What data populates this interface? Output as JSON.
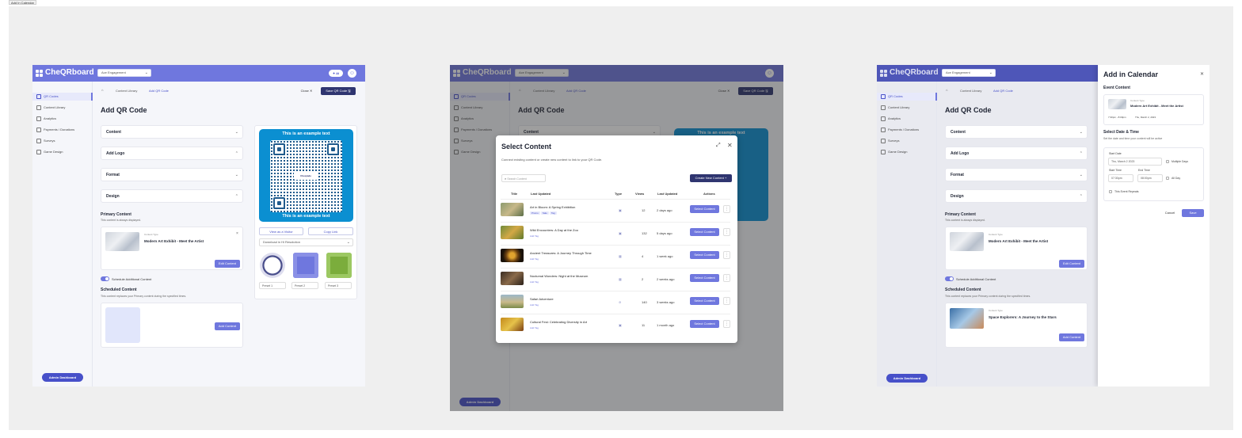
{
  "frame_label": "Add In Calendar",
  "app": {
    "logo": "CheQRboard",
    "engagement_select": "Ace Engagement",
    "ai_pill": "✦ AI",
    "nav": [
      "QR Codes",
      "Content Library",
      "Analytics",
      "Payments / Donations",
      "Surveys",
      "Game Design"
    ],
    "admin_button": "Admin Dashboard"
  },
  "breadcrumb": {
    "content_library": "Content Library",
    "add_qr": "Add QR Code"
  },
  "toolbar": {
    "close": "Close ✕",
    "save": "Save QR Code 🖫"
  },
  "page_title": "Add QR Code",
  "accordions": [
    "Content",
    "Add Logo",
    "Format",
    "Design"
  ],
  "primary": {
    "title": "Primary Content",
    "subtitle": "This content is always displayed.",
    "content_type_label": "Content Type",
    "content_title": "Modern Art Exhibit - Meet the Artist",
    "edit_button": "Edit Content"
  },
  "schedule": {
    "toggle_label": "Schedule Additional Content",
    "title": "Scheduled Content",
    "subtitle": "This content replaces your Primary content during the specified times.",
    "add_button": "Add Content",
    "second_type_label": "Content Type",
    "second_title": "Space Explorers: A Journey to the Stars",
    "second_add_button": "Add Content"
  },
  "preview": {
    "top_text": "This is an example text",
    "bottom_text": "This is an example text",
    "qr_logo": "Cheqrade",
    "view_visitor": "View as a Visitor",
    "copy_link": "Copy Link",
    "download": "Download in Hi Resolution",
    "presets": [
      "Preset 1",
      "Preset 2",
      "Preset 3"
    ]
  },
  "select_modal": {
    "title": "Select Content",
    "subtitle": "Connect existing content or create new content to link to your QR Code.",
    "search_placeholder": "Search Content",
    "create_button": "Create New Content",
    "columns": [
      "Title",
      "Last Updated",
      "Type",
      "Views",
      "Last Updated",
      "Actions"
    ],
    "rows": [
      {
        "title": "Art in Bloom: A Spring Exhibition",
        "tags": [
          "Promo",
          "Sale",
          "Tag"
        ],
        "type": "▣",
        "views": "12",
        "updated": "2 days ago"
      },
      {
        "title": "Wild Encounters: A Day at the Zoo",
        "tags": [
          "Add Tag"
        ],
        "type": "▣",
        "views": "132",
        "updated": "5 days ago"
      },
      {
        "title": "Ancient Treasures: A Journey Through Time",
        "tags": [
          "Add Tag"
        ],
        "type": "▦",
        "views": "4",
        "updated": "1 week ago"
      },
      {
        "title": "Nocturnal Wonders: Night at the Museum",
        "tags": [
          "Add Tag"
        ],
        "type": "▦",
        "views": "2",
        "updated": "2 weeks ago"
      },
      {
        "title": "Safari Adventure",
        "tags": [
          "Add Tag"
        ],
        "type": "⊘",
        "views": "140",
        "updated": "3 weeks ago"
      },
      {
        "title": "Cultural Fest: Celebrating Diversity in Art",
        "tags": [
          "Add Tag"
        ],
        "type": "▣",
        "views": "11",
        "updated": "1 month ago"
      }
    ],
    "row_button": "Select Content"
  },
  "calendar_panel": {
    "title": "Add in Calendar",
    "event_content": "Event Content",
    "content_type_label": "Content Type",
    "content_title": "Modern Art Exhibit - Meet the Artist",
    "time_range": "7:30pm - 8:00pm",
    "date_text": "Thu, March 2, 2023",
    "select_date_time": "Select Date & Time",
    "select_sub": "Set the date and time your content will be active",
    "start_date_label": "Start Date",
    "start_date": "Thu, March 2 2023",
    "multiple_days": "Multiple Days",
    "start_time_label": "Start Time",
    "end_time_label": "End Time",
    "start_time": "07:30pm",
    "end_time": "08:00pm",
    "all_day": "All Day",
    "repeats": "This Event Repeats",
    "cancel": "Cancel",
    "save": "Save"
  }
}
